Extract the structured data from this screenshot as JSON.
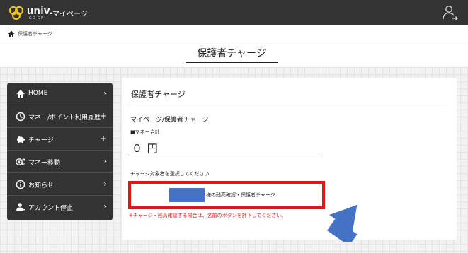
{
  "header": {
    "logo_text": "univ.",
    "logo_sub": "CO-OP",
    "mypage_label": "マイページ"
  },
  "breadcrumb": {
    "current": "保護者チャージ"
  },
  "page": {
    "title": "保護者チャージ"
  },
  "sidebar": {
    "items": [
      {
        "label": "HOME",
        "icon": "home-icon",
        "indicator": "›"
      },
      {
        "label": "マネー/ポイント利用履歴",
        "icon": "clock-icon",
        "indicator": "+"
      },
      {
        "label": "チャージ",
        "icon": "piggy-bank-icon",
        "indicator": "+"
      },
      {
        "label": "マネー移動",
        "icon": "money-transfer-icon",
        "indicator": "›"
      },
      {
        "label": "お知らせ",
        "icon": "info-icon",
        "indicator": "›"
      },
      {
        "label": "アカウント停止",
        "icon": "account-stop-icon",
        "indicator": "›"
      }
    ]
  },
  "content": {
    "title": "保護者チャージ",
    "path": "マイページ/保護者チャージ",
    "money_label": "■マネー合計",
    "money_value": "０ 円",
    "select_label": "チャージ対象者を選択してください",
    "charge_button_label": "様の残高確認・保護者チャージ",
    "note": "※チャージ・残高確認する場合は、名前のボタンを押下してください。"
  },
  "colors": {
    "header_bg": "#333333",
    "sidebar_bg": "#333333",
    "highlight_border": "#ee1111",
    "name_mask": "#4472c4",
    "note_text": "#e61c1c",
    "pointer_arrow": "#4472c4"
  }
}
